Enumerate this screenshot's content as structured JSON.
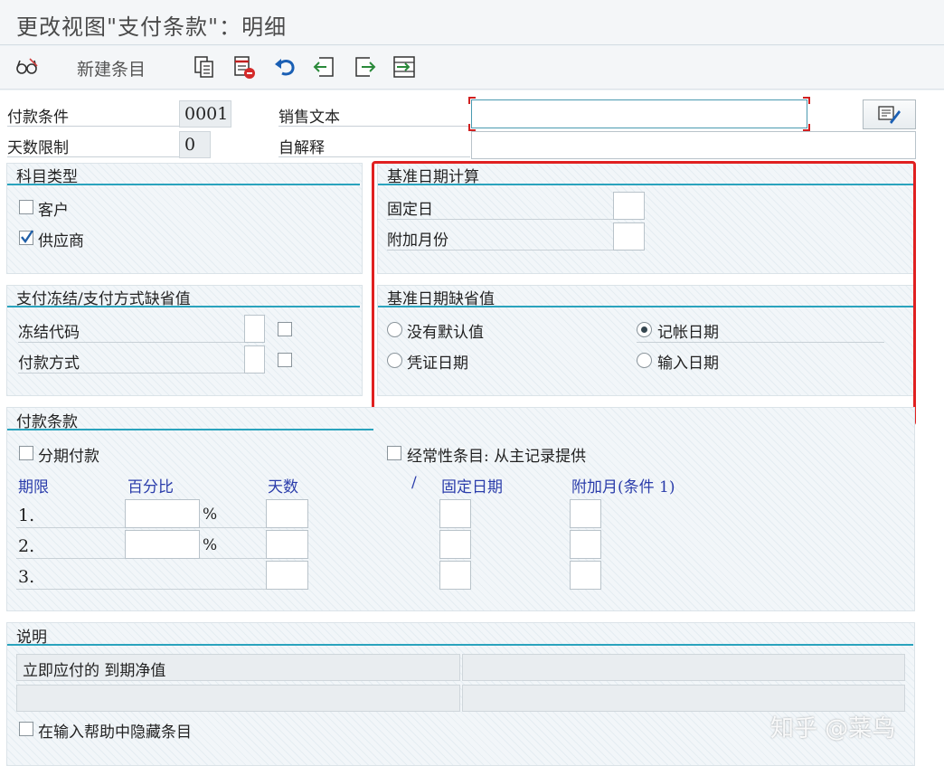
{
  "window": {
    "title": "更改视图\"支付条款\"：明细"
  },
  "toolbar": {
    "new_entries_label": "新建条目",
    "icons": [
      "glasses-icon",
      "copy-icon",
      "delete-icon",
      "undo-icon",
      "previous-entry-icon",
      "next-entry-icon",
      "select-all-icon"
    ]
  },
  "header": {
    "payment_terms_label": "付款条件",
    "payment_terms_value": "0001",
    "day_limit_label": "天数限制",
    "day_limit_value": "0",
    "sales_text_label": "销售文本",
    "sales_text_value": "",
    "own_explanation_label": "自解释",
    "own_explanation_value": ""
  },
  "account_type": {
    "title": "科目类型",
    "customer_label": "客户",
    "customer_checked": false,
    "vendor_label": "供应商",
    "vendor_checked": true
  },
  "baseline_calc": {
    "title": "基准日期计算",
    "fixed_day_label": "固定日",
    "fixed_day_value": "",
    "additional_months_label": "附加月份",
    "additional_months_value": ""
  },
  "block_defaults": {
    "title": "支付冻结/支付方式缺省值",
    "block_key_label": "冻结代码",
    "payment_method_label": "付款方式"
  },
  "baseline_default": {
    "title": "基准日期缺省值",
    "no_default_label": "没有默认值",
    "posting_date_label": "记帐日期",
    "document_date_label": "凭证日期",
    "entry_date_label": "输入日期",
    "selected": "posting_date"
  },
  "terms": {
    "title": "付款条款",
    "installment_label": "分期付款",
    "recurring_label": "经常性条目: 从主记录提供",
    "col_term": "期限",
    "col_percent": "百分比",
    "col_days": "天数",
    "col_slash": "/",
    "col_fixed_date": "固定日期",
    "col_add_month": "附加月(条件 1)",
    "percent_sign": "%",
    "rows": [
      {
        "label": "1.",
        "percent": "",
        "days": "",
        "fixed": "",
        "month": ""
      },
      {
        "label": "2.",
        "percent": "",
        "days": "",
        "fixed": "",
        "month": ""
      },
      {
        "label": "3.",
        "days": "",
        "fixed": "",
        "month": ""
      }
    ]
  },
  "explanation": {
    "title": "说明",
    "line1_left": "立即应付的 到期净值",
    "line1_right": "",
    "line2_left": "",
    "line2_right": "",
    "hide_label": "在输入帮助中隐藏条目"
  },
  "watermark": "知乎 @菜鸟",
  "colors": {
    "accent_rule": "#2aa3bd",
    "highlight_box": "#e02020",
    "column_header": "#2b3dab"
  }
}
